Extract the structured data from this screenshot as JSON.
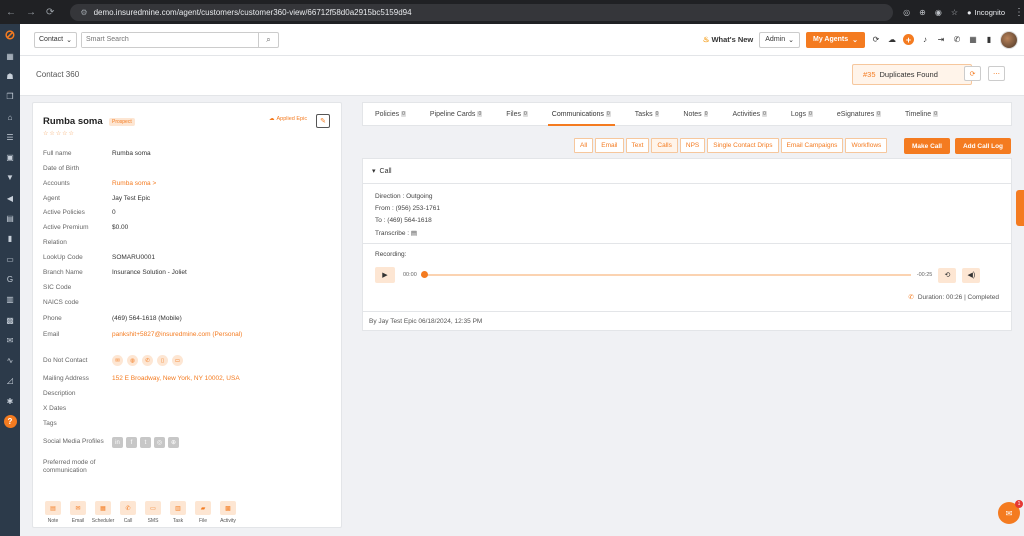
{
  "browser": {
    "url": "demo.insuredmine.com/agent/customers/customer360-view/66712f58d0a2915bc5159d94",
    "mode_label": "Incognito"
  },
  "header": {
    "contact_select": "Contact",
    "search_placeholder": "Smart Search",
    "whats_new": "What's New",
    "admin_select": "Admin",
    "agents_button": "My Agents"
  },
  "subheader": {
    "title": "Contact 360",
    "dup_count": "#35",
    "dup_label": "Duplicates Found"
  },
  "contact": {
    "name": "Rumba soma",
    "status_badge": "Prospect",
    "applied_label": "Applied Epic",
    "fields": [
      {
        "label": "Full name",
        "value": "Rumba soma",
        "link": false
      },
      {
        "label": "Date of Birth",
        "value": "",
        "link": false
      },
      {
        "label": "Accounts",
        "value": "Rumba soma >",
        "link": true
      },
      {
        "label": "Agent",
        "value": "Jay Test Epic",
        "link": false
      },
      {
        "label": "Active Policies",
        "value": "0",
        "link": false
      },
      {
        "label": "Active Premium",
        "value": "$0.00",
        "link": false
      },
      {
        "label": "Relation",
        "value": "",
        "link": false
      },
      {
        "label": "LookUp Code",
        "value": "SOMARU0001",
        "link": false
      },
      {
        "label": "Branch Name",
        "value": "Insurance Solution - Joliet",
        "link": false
      },
      {
        "label": "SIC Code",
        "value": "",
        "link": false
      },
      {
        "label": "NAICS code",
        "value": "",
        "link": false
      },
      {
        "label": "Phone",
        "value": "(469) 564-1618 (Mobile)",
        "link": false
      },
      {
        "label": "Email",
        "value": "pankshit+5827@insuredmine.com  (Personal)",
        "link": true
      }
    ],
    "fields2": [
      {
        "label": "Do Not Contact",
        "value": "",
        "link": false
      },
      {
        "label": "Mailing Address",
        "value": "152 E Broadway, New York, NY 10002, USA",
        "link": true
      },
      {
        "label": "Description",
        "value": "",
        "link": false
      },
      {
        "label": "X Dates",
        "value": "",
        "link": false
      },
      {
        "label": "Tags",
        "value": "",
        "link": false
      },
      {
        "label": "Social Media Profiles",
        "value": "",
        "link": false
      }
    ],
    "preferred_label_1": "Preferred mode of",
    "preferred_label_2": "communication",
    "actions": [
      "Note",
      "Email",
      "Scheduler",
      "Call",
      "SMS",
      "Task",
      "File",
      "Activity"
    ]
  },
  "tabs": [
    {
      "label": "Policies",
      "count": "0"
    },
    {
      "label": "Pipeline Cards",
      "count": "0"
    },
    {
      "label": "Files",
      "count": "0"
    },
    {
      "label": "Communications",
      "count": "0"
    },
    {
      "label": "Tasks",
      "count": "0"
    },
    {
      "label": "Notes",
      "count": "0"
    },
    {
      "label": "Activities",
      "count": "0"
    },
    {
      "label": "Logs",
      "count": "0"
    },
    {
      "label": "eSignatures",
      "count": "0"
    },
    {
      "label": "Timeline",
      "count": "0"
    }
  ],
  "active_tab": "Communications",
  "filters": [
    "All",
    "Email",
    "Text",
    "Calls",
    "NPS",
    "Single Contact Drips",
    "Email Campaigns",
    "Workflows"
  ],
  "active_filter": "Calls",
  "make_call": "Make Call",
  "add_call_log": "Add Call Log",
  "call": {
    "heading": "Call",
    "direction": "Direction : Outgoing",
    "from": "From : (956) 253-1761",
    "to": "To : (469) 564-1618",
    "transcribe": "Transcribe :",
    "recording": "Recording:",
    "time_current": "00:00",
    "time_remaining": "-00:25",
    "progress": 0,
    "duration": "Duration: 00:26 | Completed",
    "byline": "By Jay Test Epic 06/18/2024, 12:35 PM"
  },
  "chat_badge": "1"
}
